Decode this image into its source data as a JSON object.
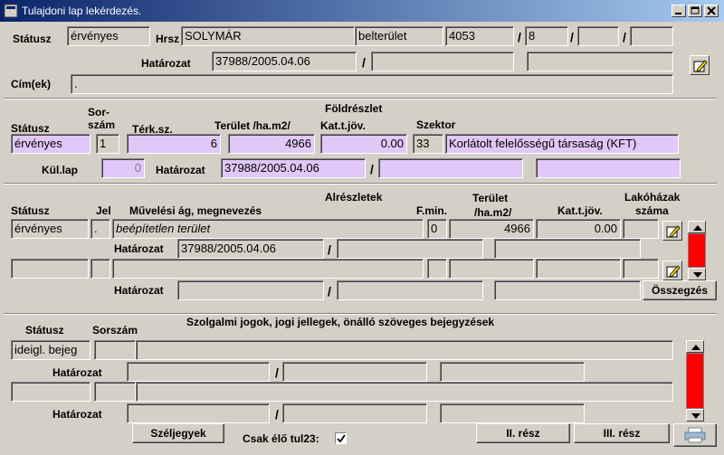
{
  "window": {
    "title": "Tulajdoni lap lekérdezés."
  },
  "top": {
    "statusz_label": "Státusz",
    "statusz_value": "érvényes",
    "hrsz_label": "Hrsz",
    "hrsz_value": "SOLYMÁR",
    "terulet_type": "belterület",
    "hrsz_num": "4053",
    "slash": "/",
    "hrsz_sub1": "8",
    "hatarozat_label": "Határozat",
    "hatarozat_value": "37988/2005.04.06",
    "cim_label": "Cím(ek)",
    "cim_value": "."
  },
  "foldreszlet": {
    "section_title": "Földrészlet",
    "statusz_label": "Státusz",
    "sorszam_label_1": "Sor-",
    "sorszam_label_2": "szám",
    "terksz_label": "Térk.sz.",
    "terulet_label": "Terület /ha.m2/",
    "katjov_label": "Kat.t.jöv.",
    "szektor_label": "Szektor",
    "statusz_value": "érvényes",
    "sorszam_value": "1",
    "terksz_value": "6",
    "terulet_value": "4966",
    "katjov_value": "0.00",
    "szektor_code": "33",
    "szektor_name": "Korlátolt felelősségű társaság (KFT)",
    "kullap_label": "Kül.lap",
    "kullap_value": "0",
    "hatarozat_label": "Határozat",
    "hatarozat_value": "37988/2005.04.06"
  },
  "alreszletek": {
    "section_title": "Alrészletek",
    "statusz_label": "Státusz",
    "jel_label": "Jel",
    "muvelesi_label": "Művelési ág,  megnevezés",
    "fmin_label": "F.min.",
    "terulet_label_1": "Terület",
    "terulet_label_2": "/ha.m2/",
    "katjov_label": "Kat.t.jöv.",
    "lakohazak_label_1": "Lakóházak",
    "lakohazak_label_2": "száma",
    "row1": {
      "statusz": "érvényes",
      "jel": ".",
      "muvelesi": "beépítetlen terület",
      "fmin": "0",
      "terulet": "4966",
      "katjov": "0.00"
    },
    "hatarozat_label": "Határozat",
    "row1_hatarozat": "37988/2005.04.06",
    "osszegzes_button": "Összegzés"
  },
  "szolgalmi": {
    "section_title": "Szolgalmi jogok, jogi jellegek, önálló szöveges bejegyzések",
    "statusz_label": "Státusz",
    "sorszam_label": "Sorszám",
    "row1_statusz": "ideigl. bejeg",
    "hatarozat_label": "Határozat"
  },
  "bottom": {
    "szeljegyek_button": "Széljegyek",
    "csak_elo_label": "Csak élő tul23:",
    "csak_elo_checked": true,
    "ii_resz_button": "II. rész",
    "iii_resz_button": "III. rész"
  },
  "icons": {
    "edit": "edit-note-icon",
    "scroll_up": "triangle-up-icon",
    "scroll_down": "triangle-down-icon"
  },
  "colors": {
    "title_start": "#0a246a",
    "title_end": "#a6caf0",
    "field_highlight": "#e0c8f8",
    "scroll_track": "#ff0000",
    "window_bg": "#d4d0c8"
  }
}
